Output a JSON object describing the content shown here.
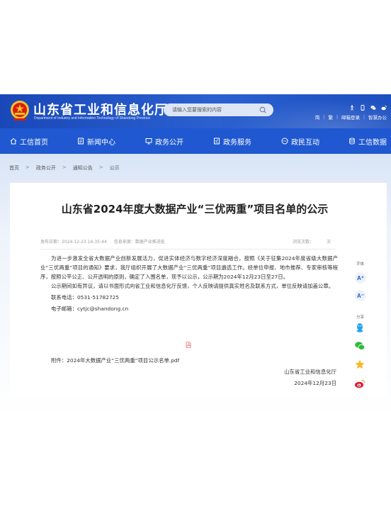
{
  "header": {
    "title": "山东省工业和信息化厅",
    "subtitle": "Department of Industry and Information Technology of Shandong Province",
    "search_placeholder": "请输入您要搜索的内容",
    "util_links": [
      "简",
      "繁",
      "邮箱登录",
      "智慧办公"
    ]
  },
  "nav": {
    "items": [
      {
        "label": "工信首页",
        "icon": "home-icon"
      },
      {
        "label": "新闻中心",
        "icon": "news-icon"
      },
      {
        "label": "政务公开",
        "icon": "monitor-icon"
      },
      {
        "label": "政务服务",
        "icon": "service-icon"
      },
      {
        "label": "政民互动",
        "icon": "chat-icon"
      },
      {
        "label": "工信数据",
        "icon": "database-icon"
      }
    ]
  },
  "breadcrumb": [
    "首页",
    "政务公开",
    "通知公告",
    "公示"
  ],
  "article": {
    "title": "山东省2024年度大数据产业“三优两重”项目名单的公示",
    "publish_date": "发布日期：2024-12-23 16:35:44",
    "source": "信息来源：数据产业推进处",
    "views_label": "浏览次数：",
    "views_unit": "次",
    "para1": "为进一步激发全省大数据产业创新发展活力，促进实体经济与数字经济深度融合，按照《关于征集2024年度省级大数据产业“三优两重”项目的通知》要求，我厅组织开展了大数据产业“三优两重”项目遴选工作。经单位申报、地市推荐、专家审核等程序，按照公平公正、公开透明的原则，确定了入围名单，现予以公示，公示期为2024年12月23日至27日。",
    "para2": "公示期间如有异议，请以书面形式向省工业和信息化厅反馈，个人反映请提供真实姓名及联系方式，单位反映请加盖公章。",
    "phone": "联系电话：0531-51782725",
    "email": "电子邮箱：cytjc@shandong.cn",
    "attachment": "附件：2024年大数据产业“三优两重”项目公示名单.pdf",
    "signer": "山东省工业和信息化厅",
    "sign_date": "2024年12月23日"
  },
  "side": {
    "font_label": "字体",
    "font_increase": "A⁺",
    "font_decrease": "A⁻",
    "share_label": "分享"
  },
  "colors": {
    "header_blue": "#1a48b8",
    "nav_blue": "#1f58d0"
  }
}
